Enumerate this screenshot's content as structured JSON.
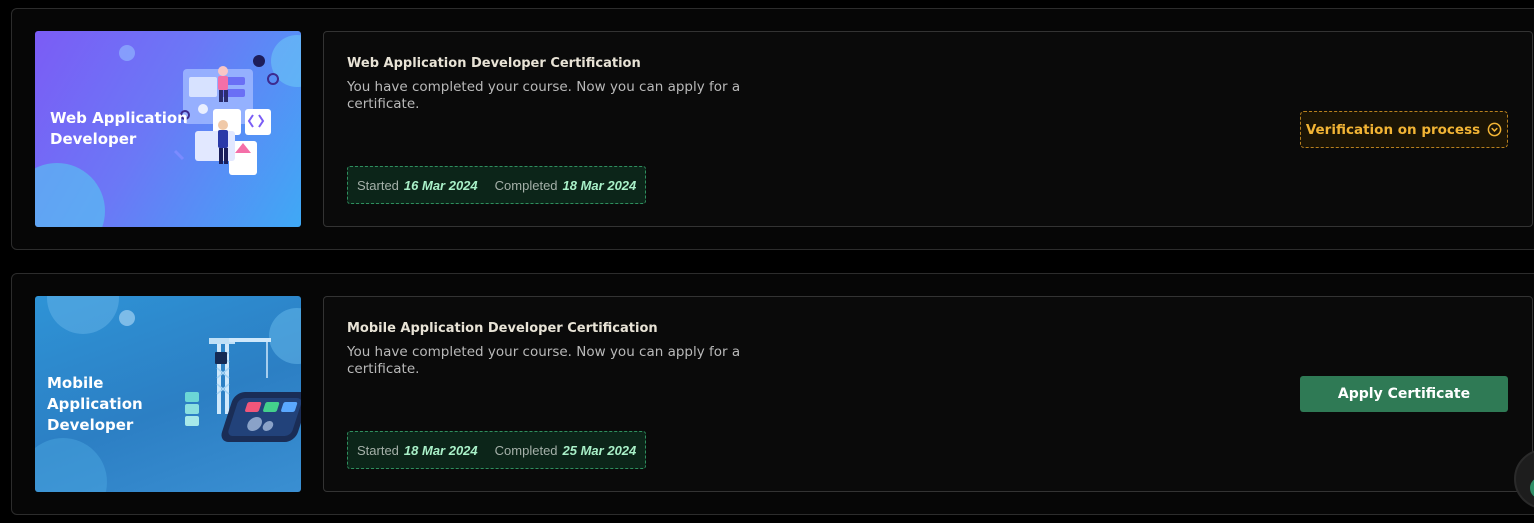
{
  "courses": [
    {
      "thumb_title_line1": "Web Application",
      "thumb_title_line2": "Developer",
      "title": "Web Application Developer Certification",
      "description": "You have completed your course. Now you can apply for a certificate.",
      "started_label": "Started",
      "started_date": "16 Mar 2024",
      "completed_label": "Completed",
      "completed_date": "18 Mar 2024",
      "status_label": "Verification on process",
      "status_icon": "clock-icon",
      "status_color": "#f2b435"
    },
    {
      "thumb_title_line1": "Mobile Application",
      "thumb_title_line2": "Developer",
      "title": "Mobile Application Developer Certification",
      "description": "You have completed your course. Now you can apply for a certificate.",
      "started_label": "Started",
      "started_date": "18 Mar 2024",
      "completed_label": "Completed",
      "completed_date": "25 Mar 2024",
      "action_label": "Apply Certificate",
      "action_color": "#2f7a55"
    }
  ],
  "colors": {
    "page_bg": "#000000",
    "card_border": "#2c2c2c",
    "date_badge_bg": "#0c2519",
    "date_badge_border": "#2f8f5e",
    "date_value": "#a9f0c8"
  }
}
